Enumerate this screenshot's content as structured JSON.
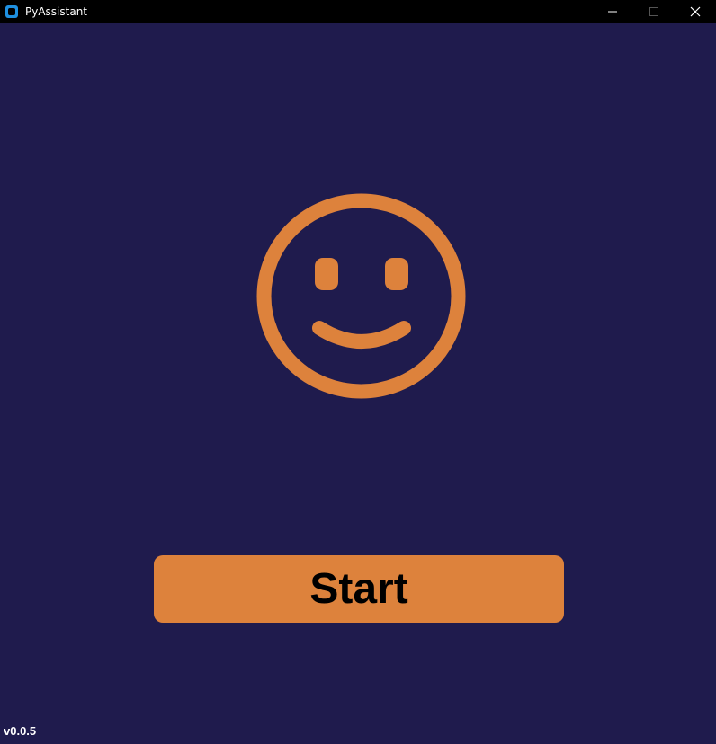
{
  "window": {
    "title": "PyAssistant",
    "app_icon": "app-window-icon",
    "controls": [
      "minimize-icon",
      "maximize-icon",
      "close-icon"
    ]
  },
  "colors": {
    "background": "#1f1b4d",
    "accent": "#dd823c",
    "titlebar": "#000000",
    "app_icon": "#1e90e0"
  },
  "main": {
    "icon": "smiley-face-icon",
    "start_label": "Start"
  },
  "footer": {
    "version": "v0.0.5"
  }
}
